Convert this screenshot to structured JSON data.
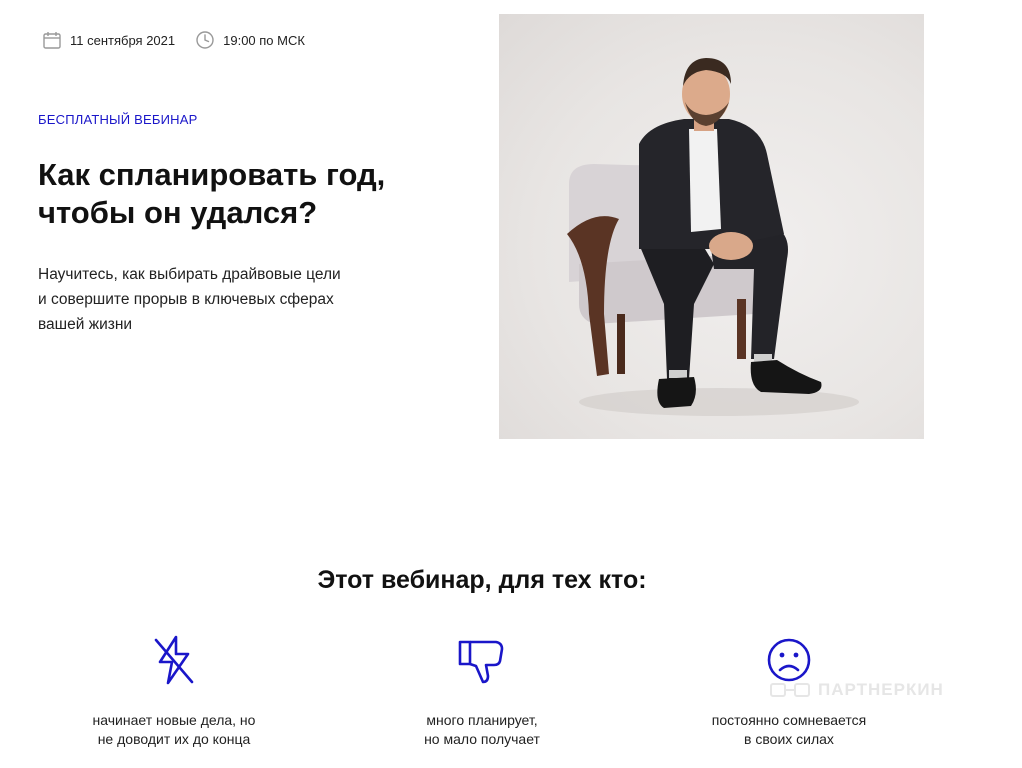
{
  "event": {
    "date": "11 сентября 2021",
    "time": "19:00 по МСК"
  },
  "hero": {
    "tag": "БЕСПЛАТНЫЙ ВЕБИНАР",
    "title_lines": [
      "Как спланировать год,",
      "чтобы он удался?"
    ],
    "description_lines": [
      "Научитесь, как выбирать драйвовые цели",
      "и совершите прорыв в ключевых сферах",
      "вашей жизни"
    ]
  },
  "audience": {
    "title": "Этот вебинар, для тех кто:",
    "items": [
      {
        "icon": "lightning-icon",
        "lines": [
          "начинает новые дела, но",
          "не доводит их до конца"
        ]
      },
      {
        "icon": "thumbs-down-icon",
        "lines": [
          "много планирует,",
          "но мало получает"
        ]
      },
      {
        "icon": "sad-face-icon",
        "lines": [
          "постоянно сомневается",
          "в своих силах"
        ]
      }
    ]
  },
  "watermark": "ПАРТНЕРКИН",
  "colors": {
    "accent": "#1a16c9",
    "text": "#111111"
  }
}
